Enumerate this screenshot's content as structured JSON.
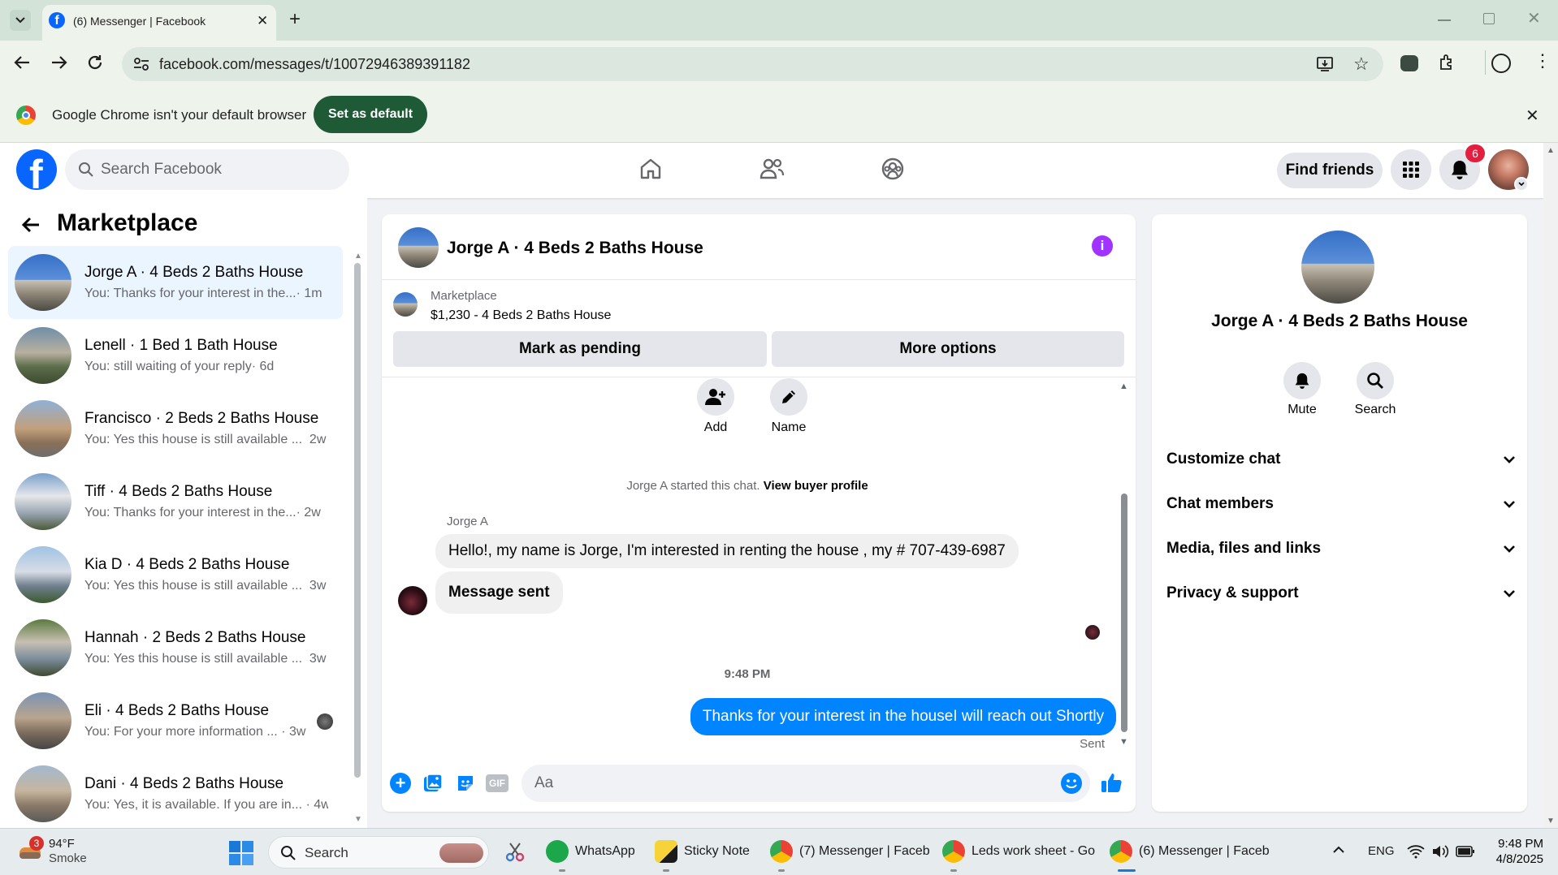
{
  "browser": {
    "tab_title": "(6) Messenger | Facebook",
    "url": "facebook.com/messages/t/10072946389391182",
    "infobar_text": "Google Chrome isn't your default browser",
    "set_default_label": "Set as default"
  },
  "fb_header": {
    "search_placeholder": "Search Facebook",
    "find_friends_label": "Find friends",
    "notification_count": "6"
  },
  "left_panel": {
    "title": "Marketplace",
    "conversations": [
      {
        "name": "Jorge A · 4 Beds 2 Baths House",
        "snippet": "You: Thanks for your interest in the...",
        "time": "· 1m"
      },
      {
        "name": "Lenell · 1 Bed 1 Bath House",
        "snippet": "You: still waiting of your reply",
        "time": "· 6d"
      },
      {
        "name": "Francisco · 2 Beds 2 Baths House",
        "snippet": "You: Yes this house is still available ...",
        "time": "2w"
      },
      {
        "name": "Tiff · 4 Beds 2 Baths House",
        "snippet": "You: Thanks for your interest in the...",
        "time": "· 2w"
      },
      {
        "name": "Kia D · 4 Beds 2 Baths House",
        "snippet": "You: Yes this house is still available ...",
        "time": "3w"
      },
      {
        "name": "Hannah · 2 Beds 2 Baths House",
        "snippet": "You: Yes this house is still available ...",
        "time": "3w"
      },
      {
        "name": "Eli · 4 Beds 2 Baths House",
        "snippet": "You: For your more information ...",
        "time": "· 3w"
      },
      {
        "name": "Dani · 4 Beds 2 Baths House",
        "snippet": "You: Yes, it is available. If you are in...",
        "time": "· 4w"
      }
    ]
  },
  "chat": {
    "title": "Jorge A · 4 Beds 2 Baths House",
    "listing_source": "Marketplace",
    "listing_detail": "$1,230 - 4 Beds 2 Baths House",
    "mark_pending_label": "Mark as pending",
    "more_options_label": "More options",
    "add_label": "Add",
    "name_label": "Name",
    "started_text": "Jorge A started this chat.",
    "view_profile_label": "View buyer profile",
    "sender_name": "Jorge A",
    "messages_in": [
      "Hello!, my name is Jorge, I'm interested in renting the house , my # 707-439-6987",
      "Message sent"
    ],
    "timestamp": "9:48 PM",
    "message_out": "Thanks for your interest in the houseI will reach out Shortly",
    "sent_status": "Sent",
    "composer_placeholder": "Aa",
    "gif_label": "GIF"
  },
  "right_panel": {
    "name": "Jorge A · 4 Beds 2 Baths House",
    "mute_label": "Mute",
    "search_label": "Search",
    "sections": [
      "Customize chat",
      "Chat members",
      "Media, files and links",
      "Privacy & support"
    ]
  },
  "taskbar": {
    "weather_temp": "94°F",
    "weather_desc": "Smoke",
    "weather_badge": "3",
    "search_label": "Search",
    "apps": [
      {
        "label": "WhatsApp"
      },
      {
        "label": "Sticky Note"
      },
      {
        "label": "(7) Messenger | Faceb"
      },
      {
        "label": "Leds work sheet - Go"
      },
      {
        "label": "(6) Messenger | Faceb"
      }
    ],
    "language": "ENG",
    "time": "9:48 PM",
    "date": "4/8/2025"
  },
  "colors": {
    "fb_blue": "#0866ff",
    "messenger_blue": "#0084ff",
    "set_default_green": "#1e5a36",
    "info_purple": "#a033ff"
  }
}
